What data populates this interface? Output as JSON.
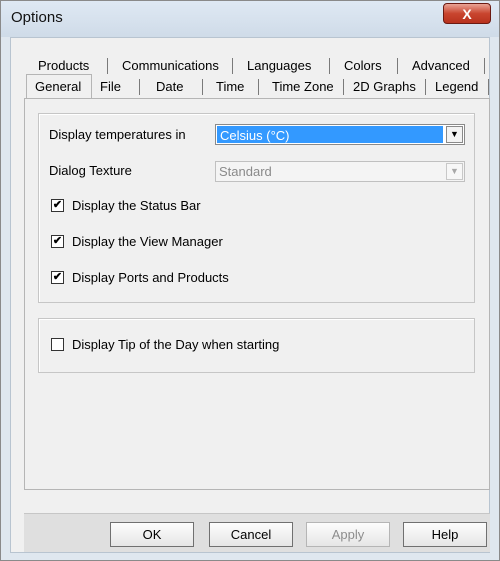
{
  "window": {
    "title": "Options",
    "close_glyph": "X"
  },
  "tabs_row1": [
    "Products",
    "Communications",
    "Languages",
    "Colors",
    "Advanced"
  ],
  "tabs_row2": [
    "General",
    "File",
    "Date",
    "Time",
    "Time Zone",
    "2D Graphs",
    "Legend"
  ],
  "active_tab": "General",
  "general": {
    "temperature_label": "Display temperatures in",
    "temperature_value": "Celsius (°C)",
    "texture_label": "Dialog Texture",
    "texture_value": "Standard",
    "status_bar_label": "Display the Status Bar",
    "status_bar_checked": true,
    "view_manager_label": "Display the View Manager",
    "view_manager_checked": true,
    "ports_label": "Display Ports and Products",
    "ports_checked": true,
    "tip_label": "Display Tip of the Day when starting",
    "tip_checked": false,
    "check_glyph": "✔",
    "dropdown_glyph": "▼"
  },
  "buttons": {
    "ok": "OK",
    "cancel": "Cancel",
    "apply": "Apply",
    "help": "Help"
  }
}
